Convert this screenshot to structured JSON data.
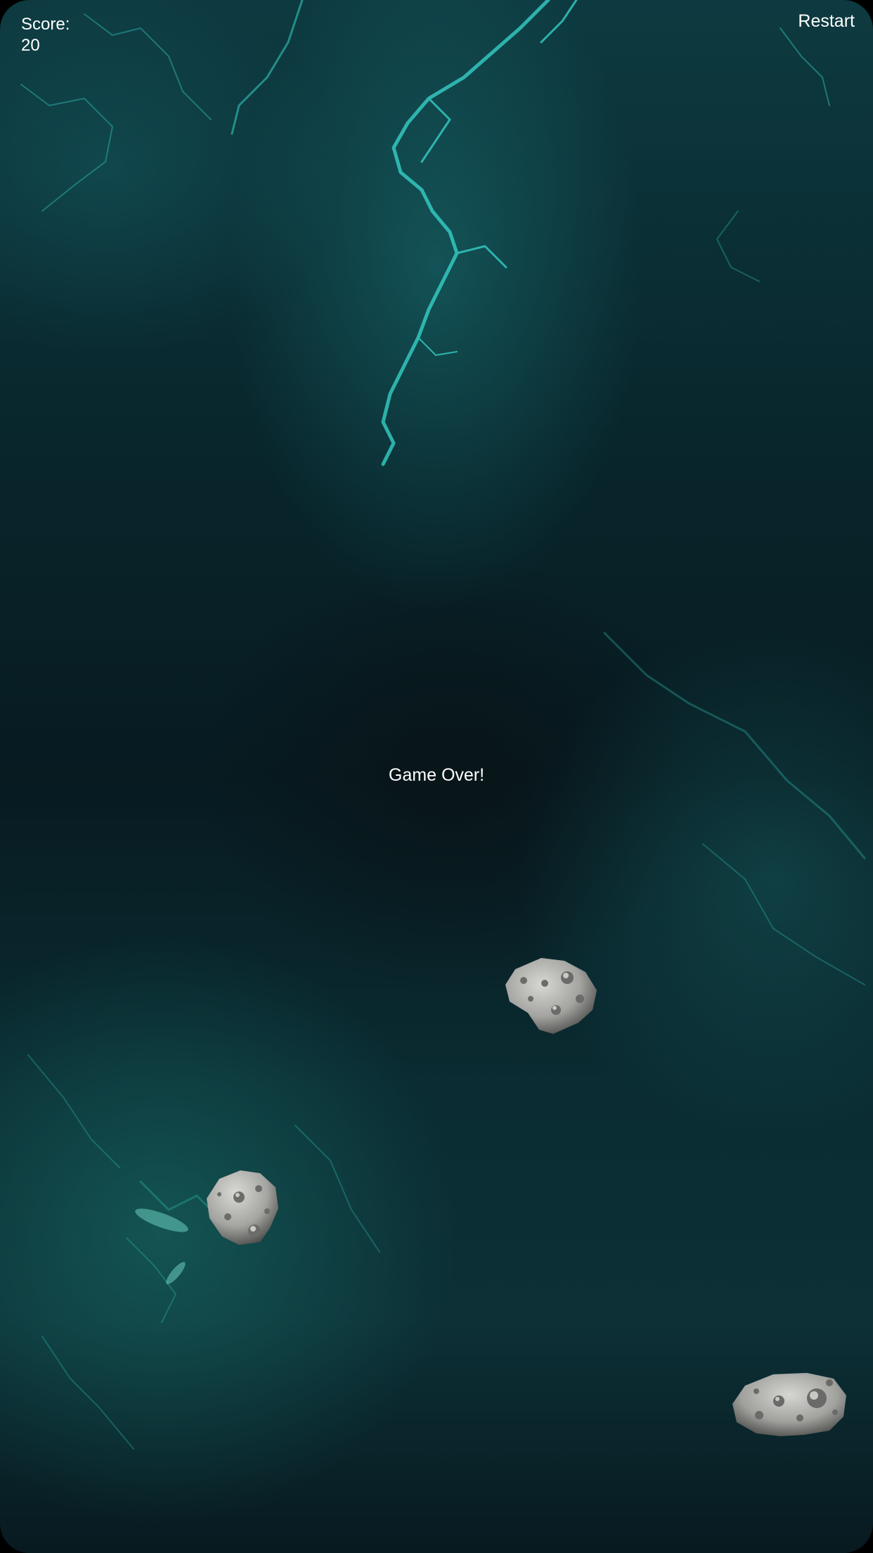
{
  "hud": {
    "score_label": "Score:",
    "score_value": "20",
    "restart_label": "Restart"
  },
  "status": {
    "message": "Game Over!"
  },
  "colors": {
    "background": "#071b21",
    "nebula": "#34d6cf",
    "text": "#ffffff",
    "asteroid": "#a9a9a6"
  },
  "sprites": {
    "asteroid_icon": "asteroid-icon",
    "asteroid_count": 3
  }
}
